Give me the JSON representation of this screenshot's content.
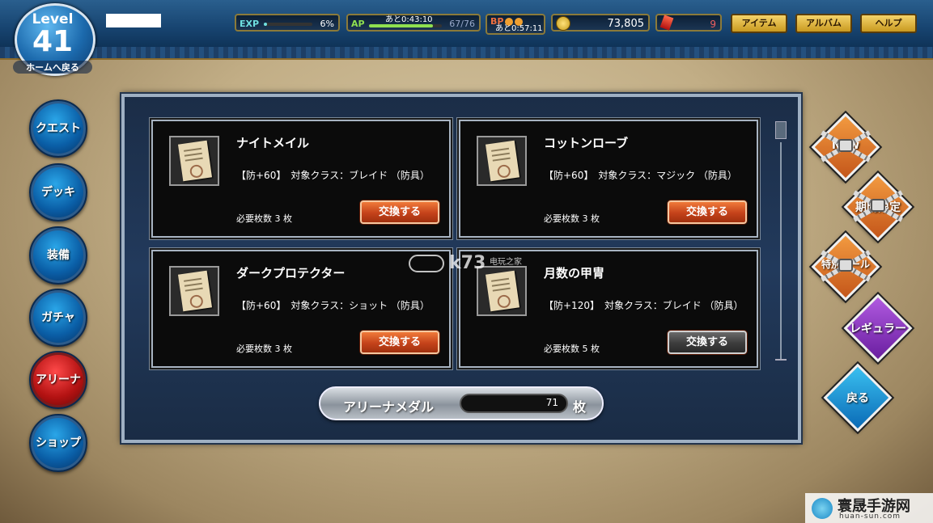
{
  "level": {
    "label": "Level",
    "value": "41",
    "home_link": "ホームへ戻る"
  },
  "stats": {
    "exp": {
      "label": "EXP",
      "value": "6%",
      "fill": 0.06
    },
    "ap": {
      "label": "AP",
      "timer": "あと0:43:10",
      "value": "67/76",
      "fill": 0.88
    },
    "bp": {
      "label": "BP",
      "timer": "あと0:57:11"
    },
    "gold": {
      "value": "73,805"
    },
    "gems": {
      "value": "9"
    }
  },
  "top_menu": {
    "item": "アイテム",
    "album": "アルバム",
    "help": "ヘルプ"
  },
  "nav": [
    {
      "label": "クエスト"
    },
    {
      "label": "デッキ"
    },
    {
      "label": "装備"
    },
    {
      "label": "ガチャ"
    },
    {
      "label": "アリーナ"
    },
    {
      "label": "ショップ"
    }
  ],
  "cards": [
    {
      "name": "ナイトメイル",
      "desc": "【防+60】　対象クラス：ブレイド （防具）",
      "req": "必要枚数 3 枚",
      "button": "交換する",
      "enabled": true
    },
    {
      "name": "コットンローブ",
      "desc": "【防+60】　対象クラス：マジック （防具）",
      "req": "必要枚数 3 枚",
      "button": "交換する",
      "enabled": true
    },
    {
      "name": "ダークプロテクター",
      "desc": "【防+60】　対象クラス：ショット （防具）",
      "req": "必要枚数 3 枚",
      "button": "交換する",
      "enabled": true
    },
    {
      "name": "月数の甲冑",
      "desc": "【防+120】　対象クラス：ブレイド （防具）",
      "req": "必要枚数 5 枚",
      "button": "交換する",
      "enabled": false
    }
  ],
  "medal": {
    "label": "アリーナメダル",
    "count": "71",
    "unit": "枚"
  },
  "right_menu": {
    "new": "New",
    "limited": "期間限定",
    "special": "特別セール",
    "regular": "レギュラー",
    "back": "戻る"
  },
  "watermark": {
    "title": "寰晟手游网",
    "sub": "huan-sun.com",
    "k73": "k73",
    "k73_sub": "电玩之家"
  },
  "colors": {
    "accent_orange": "#c4421a",
    "panel_blue": "#1b2d47",
    "gold": "#c99a20"
  }
}
